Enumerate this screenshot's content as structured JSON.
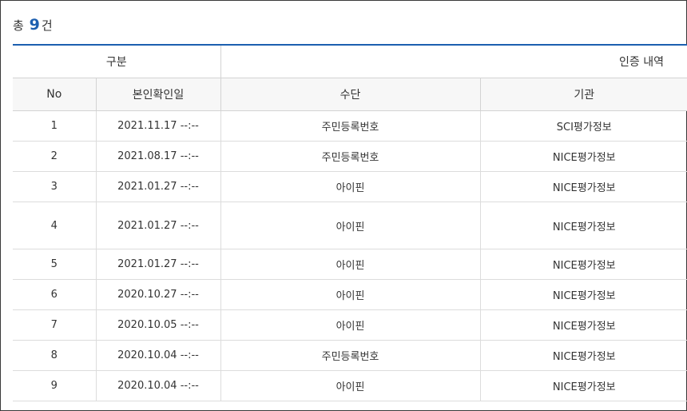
{
  "summary": {
    "prefix": "총",
    "count": "9",
    "suffix": "건"
  },
  "header": {
    "group_labels": [
      "구분",
      "인증 내역"
    ],
    "columns": [
      "No",
      "본인확인일",
      "수단",
      "기관"
    ]
  },
  "rows": [
    {
      "no": "1",
      "date": "2021.11.17 --:--",
      "method": "주민등록번호",
      "org": "SCI평가정보"
    },
    {
      "no": "2",
      "date": "2021.08.17 --:--",
      "method": "주민등록번호",
      "org": "NICE평가정보"
    },
    {
      "no": "3",
      "date": "2021.01.27 --:--",
      "method": "아이핀",
      "org": "NICE평가정보"
    },
    {
      "no": "4",
      "date": "2021.01.27 --:--",
      "method": "아이핀",
      "org": "NICE평가정보"
    },
    {
      "no": "5",
      "date": "2021.01.27 --:--",
      "method": "아이핀",
      "org": "NICE평가정보"
    },
    {
      "no": "6",
      "date": "2020.10.27 --:--",
      "method": "아이핀",
      "org": "NICE평가정보"
    },
    {
      "no": "7",
      "date": "2020.10.05 --:--",
      "method": "아이핀",
      "org": "NICE평가정보"
    },
    {
      "no": "8",
      "date": "2020.10.04 --:--",
      "method": "주민등록번호",
      "org": "NICE평가정보"
    },
    {
      "no": "9",
      "date": "2020.10.04 --:--",
      "method": "아이핀",
      "org": "NICE평가정보"
    }
  ],
  "colors": {
    "accent": "#1c5fb0",
    "header_bg": "#f7f7f7",
    "border": "#d3d3d3",
    "text": "#333333"
  }
}
